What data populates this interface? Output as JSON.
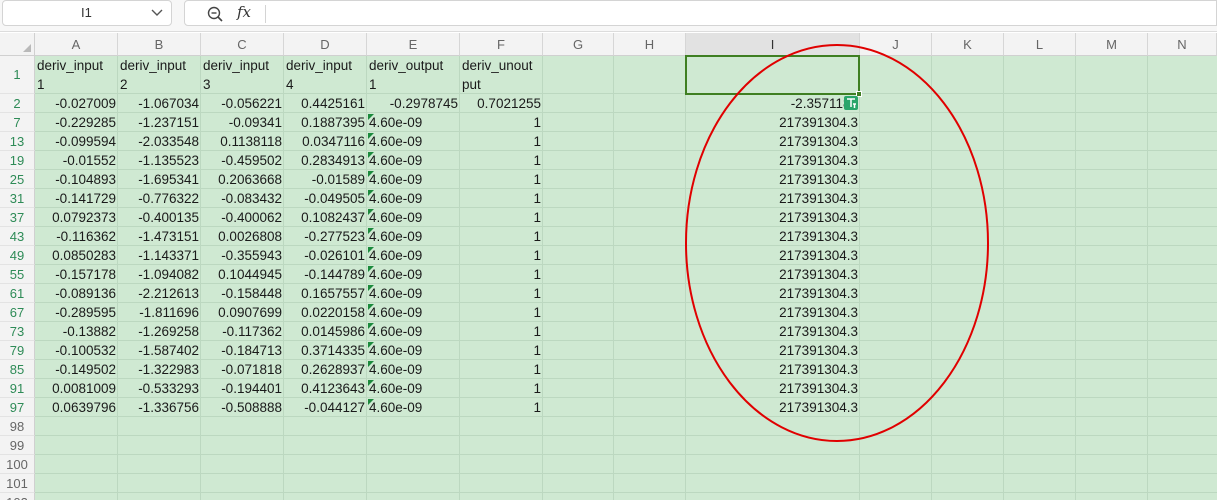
{
  "formula_bar": {
    "name_box_value": "I1",
    "zoom_icon": "zoom-icon",
    "fx_label": "fx",
    "formula_value": ""
  },
  "columns": [
    "A",
    "B",
    "C",
    "D",
    "E",
    "F",
    "G",
    "H",
    "I",
    "J",
    "K",
    "L",
    "M",
    "N"
  ],
  "selected_column": "I",
  "header_row": {
    "row_number": "1",
    "cells": [
      {
        "line1": "deriv_input",
        "line2": "1"
      },
      {
        "line1": "deriv_input",
        "line2": "2"
      },
      {
        "line1": "deriv_input",
        "line2": "3"
      },
      {
        "line1": "deriv_input",
        "line2": "4"
      },
      {
        "line1": "deriv_output",
        "line2": "1"
      },
      {
        "line1": "deriv_unout",
        "line2": "put"
      }
    ]
  },
  "rows": [
    {
      "n": "2",
      "a": "-0.027009",
      "b": "-1.067034",
      "c": "-0.056221",
      "d": "0.4425161",
      "e": "-0.2978745",
      "f": "0.7021255",
      "i": "-2.3571185"
    },
    {
      "n": "7",
      "a": "-0.229285",
      "b": "-1.237151",
      "c": "-0.09341",
      "d": "0.1887395",
      "e": "4.60e-09",
      "f": "1",
      "i": "217391304.3"
    },
    {
      "n": "13",
      "a": "-0.099594",
      "b": "-2.033548",
      "c": "0.1138118",
      "d": "0.0347116",
      "e": "4.60e-09",
      "f": "1",
      "i": "217391304.3"
    },
    {
      "n": "19",
      "a": "-0.01552",
      "b": "-1.135523",
      "c": "-0.459502",
      "d": "0.2834913",
      "e": "4.60e-09",
      "f": "1",
      "i": "217391304.3"
    },
    {
      "n": "25",
      "a": "-0.104893",
      "b": "-1.695341",
      "c": "0.2063668",
      "d": "-0.01589",
      "e": "4.60e-09",
      "f": "1",
      "i": "217391304.3"
    },
    {
      "n": "31",
      "a": "-0.141729",
      "b": "-0.776322",
      "c": "-0.083432",
      "d": "-0.049505",
      "e": "4.60e-09",
      "f": "1",
      "i": "217391304.3"
    },
    {
      "n": "37",
      "a": "0.0792373",
      "b": "-0.400135",
      "c": "-0.400062",
      "d": "0.1082437",
      "e": "4.60e-09",
      "f": "1",
      "i": "217391304.3"
    },
    {
      "n": "43",
      "a": "-0.116362",
      "b": "-1.473151",
      "c": "0.0026808",
      "d": "-0.277523",
      "e": "4.60e-09",
      "f": "1",
      "i": "217391304.3"
    },
    {
      "n": "49",
      "a": "0.0850283",
      "b": "-1.143371",
      "c": "-0.355943",
      "d": "-0.026101",
      "e": "4.60e-09",
      "f": "1",
      "i": "217391304.3"
    },
    {
      "n": "55",
      "a": "-0.157178",
      "b": "-1.094082",
      "c": "0.1044945",
      "d": "-0.144789",
      "e": "4.60e-09",
      "f": "1",
      "i": "217391304.3"
    },
    {
      "n": "61",
      "a": "-0.089136",
      "b": "-2.212613",
      "c": "-0.158448",
      "d": "0.1657557",
      "e": "4.60e-09",
      "f": "1",
      "i": "217391304.3"
    },
    {
      "n": "67",
      "a": "-0.289595",
      "b": "-1.811696",
      "c": "0.0907699",
      "d": "0.0220158",
      "e": "4.60e-09",
      "f": "1",
      "i": "217391304.3"
    },
    {
      "n": "73",
      "a": "-0.13882",
      "b": "-1.269258",
      "c": "-0.117362",
      "d": "0.0145986",
      "e": "4.60e-09",
      "f": "1",
      "i": "217391304.3"
    },
    {
      "n": "79",
      "a": "-0.100532",
      "b": "-1.587402",
      "c": "-0.184713",
      "d": "0.3714335",
      "e": "4.60e-09",
      "f": "1",
      "i": "217391304.3"
    },
    {
      "n": "85",
      "a": "-0.149502",
      "b": "-1.322983",
      "c": "-0.071818",
      "d": "0.2628937",
      "e": "4.60e-09",
      "f": "1",
      "i": "217391304.3"
    },
    {
      "n": "91",
      "a": "0.0081009",
      "b": "-0.533293",
      "c": "-0.194401",
      "d": "0.4123643",
      "e": "4.60e-09",
      "f": "1",
      "i": "217391304.3"
    },
    {
      "n": "97",
      "a": "0.0639796",
      "b": "-1.336756",
      "c": "-0.508888",
      "d": "-0.044127",
      "e": "4.60e-09",
      "f": "1",
      "i": "217391304.3"
    }
  ],
  "empty_rows": [
    "98",
    "99",
    "100",
    "101",
    "102"
  ],
  "colors": {
    "cell_background": "#cfe9d2",
    "selection_border": "#3f7f22",
    "annotation_circle": "#e00000",
    "row_number_text": "#2e8b57"
  }
}
